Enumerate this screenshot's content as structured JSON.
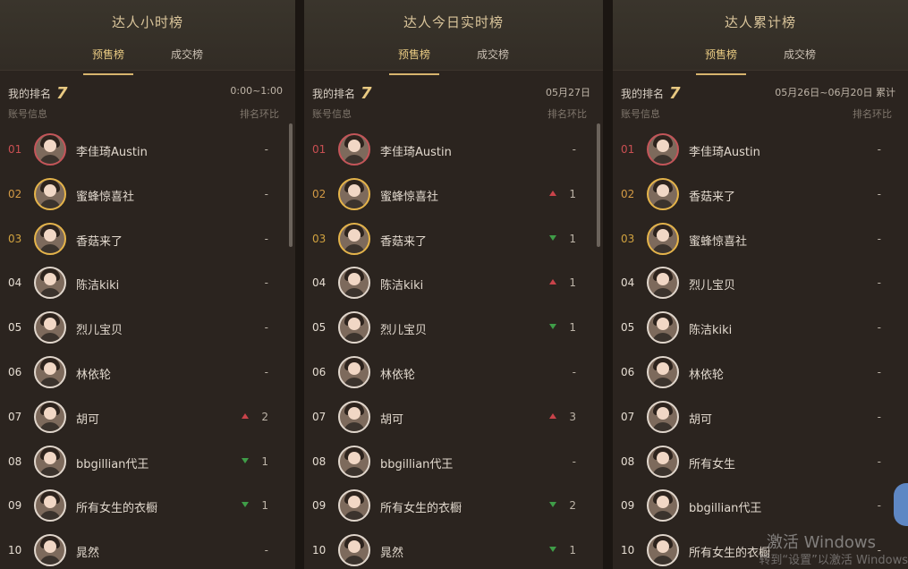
{
  "panels": [
    {
      "title": "达人小时榜",
      "tabs": [
        "预售榜",
        "成交榜"
      ],
      "my_rank_label": "我的排名",
      "my_rank_value": "7",
      "period": "0:00~1:00",
      "col_account": "账号信息",
      "col_compare": "排名环比",
      "rows": [
        {
          "rank": "01",
          "name": "李佳琦Austin",
          "trend": "",
          "value": "-"
        },
        {
          "rank": "02",
          "name": "蜜蜂惊喜社",
          "trend": "",
          "value": "-"
        },
        {
          "rank": "03",
          "name": "香菇来了",
          "trend": "",
          "value": "-"
        },
        {
          "rank": "04",
          "name": "陈洁kiki",
          "trend": "",
          "value": "-"
        },
        {
          "rank": "05",
          "name": "烈儿宝贝",
          "trend": "",
          "value": "-"
        },
        {
          "rank": "06",
          "name": "林依轮",
          "trend": "",
          "value": "-"
        },
        {
          "rank": "07",
          "name": "胡可",
          "trend": "up",
          "value": "2"
        },
        {
          "rank": "08",
          "name": "bbgillian代王",
          "trend": "down",
          "value": "1"
        },
        {
          "rank": "09",
          "name": "所有女生的衣橱",
          "trend": "down",
          "value": "1"
        },
        {
          "rank": "10",
          "name": "晁然",
          "trend": "",
          "value": "-"
        }
      ]
    },
    {
      "title": "达人今日实时榜",
      "tabs": [
        "预售榜",
        "成交榜"
      ],
      "my_rank_label": "我的排名",
      "my_rank_value": "7",
      "period": "05月27日",
      "col_account": "账号信息",
      "col_compare": "排名环比",
      "rows": [
        {
          "rank": "01",
          "name": "李佳琦Austin",
          "trend": "",
          "value": "-"
        },
        {
          "rank": "02",
          "name": "蜜蜂惊喜社",
          "trend": "up",
          "value": "1"
        },
        {
          "rank": "03",
          "name": "香菇来了",
          "trend": "down",
          "value": "1"
        },
        {
          "rank": "04",
          "name": "陈洁kiki",
          "trend": "up",
          "value": "1"
        },
        {
          "rank": "05",
          "name": "烈儿宝贝",
          "trend": "down",
          "value": "1"
        },
        {
          "rank": "06",
          "name": "林依轮",
          "trend": "",
          "value": "-"
        },
        {
          "rank": "07",
          "name": "胡可",
          "trend": "up",
          "value": "3"
        },
        {
          "rank": "08",
          "name": "bbgillian代王",
          "trend": "",
          "value": "-"
        },
        {
          "rank": "09",
          "name": "所有女生的衣橱",
          "trend": "down",
          "value": "2"
        },
        {
          "rank": "10",
          "name": "晁然",
          "trend": "down",
          "value": "1"
        }
      ]
    },
    {
      "title": "达人累计榜",
      "tabs": [
        "预售榜",
        "成交榜"
      ],
      "my_rank_label": "我的排名",
      "my_rank_value": "7",
      "period": "05月26日~06月20日 累计",
      "col_account": "账号信息",
      "col_compare": "排名环比",
      "rows": [
        {
          "rank": "01",
          "name": "李佳琦Austin",
          "trend": "",
          "value": "-"
        },
        {
          "rank": "02",
          "name": "香菇来了",
          "trend": "",
          "value": "-"
        },
        {
          "rank": "03",
          "name": "蜜蜂惊喜社",
          "trend": "",
          "value": "-"
        },
        {
          "rank": "04",
          "name": "烈儿宝贝",
          "trend": "",
          "value": "-"
        },
        {
          "rank": "05",
          "name": "陈洁kiki",
          "trend": "",
          "value": "-"
        },
        {
          "rank": "06",
          "name": "林依轮",
          "trend": "",
          "value": "-"
        },
        {
          "rank": "07",
          "name": "胡可",
          "trend": "",
          "value": "-"
        },
        {
          "rank": "08",
          "name": "所有女生",
          "trend": "",
          "value": "-"
        },
        {
          "rank": "09",
          "name": "bbgillian代王",
          "trend": "",
          "value": "-"
        },
        {
          "rank": "10",
          "name": "所有女生的衣橱",
          "trend": "",
          "value": "-"
        }
      ]
    }
  ],
  "watermark": {
    "line1": "激活 Windows",
    "line2": "转到“设置”以激活 Windows"
  }
}
